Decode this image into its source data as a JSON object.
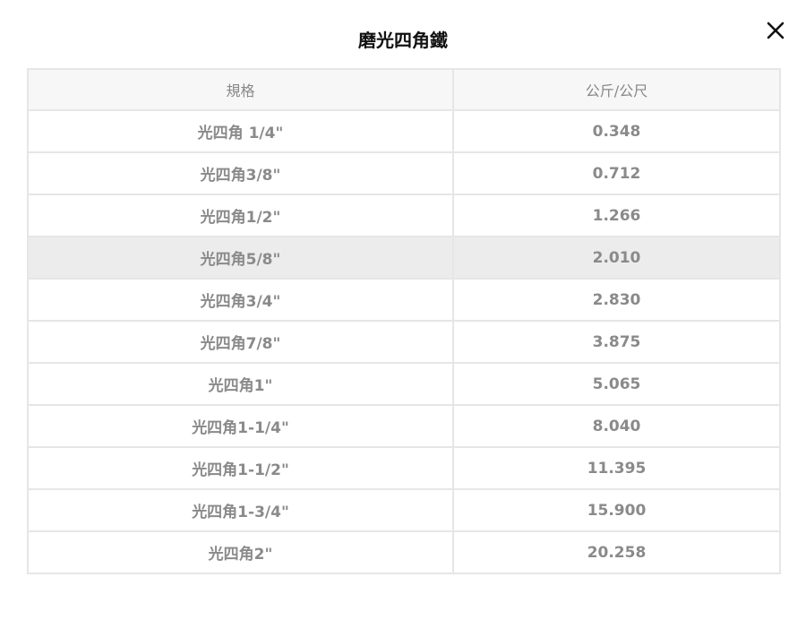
{
  "title": "磨光四角鐵",
  "table": {
    "headers": [
      "規格",
      "公斤/公尺"
    ],
    "rows": [
      {
        "spec": "光四角 1/4\"",
        "weight": "0.348"
      },
      {
        "spec": "光四角3/8\"",
        "weight": "0.712"
      },
      {
        "spec": "光四角1/2\"",
        "weight": "1.266"
      },
      {
        "spec": "光四角5/8\"",
        "weight": "2.010"
      },
      {
        "spec": "光四角3/4\"",
        "weight": "2.830"
      },
      {
        "spec": "光四角7/8\"",
        "weight": "3.875"
      },
      {
        "spec": "光四角1\"",
        "weight": "5.065"
      },
      {
        "spec": "光四角1-1/4\"",
        "weight": "8.040"
      },
      {
        "spec": "光四角1-1/2\"",
        "weight": "11.395"
      },
      {
        "spec": "光四角1-3/4\"",
        "weight": "15.900"
      },
      {
        "spec": "光四角2\"",
        "weight": "20.258"
      }
    ],
    "highlighted_row": 3
  },
  "icons": {
    "close": "close-icon"
  },
  "colors": {
    "header_bg": "#f7f7f7",
    "highlight_bg": "#ececec",
    "border": "#e6e6e6",
    "text": "#8a8a8a",
    "title": "#111111"
  }
}
